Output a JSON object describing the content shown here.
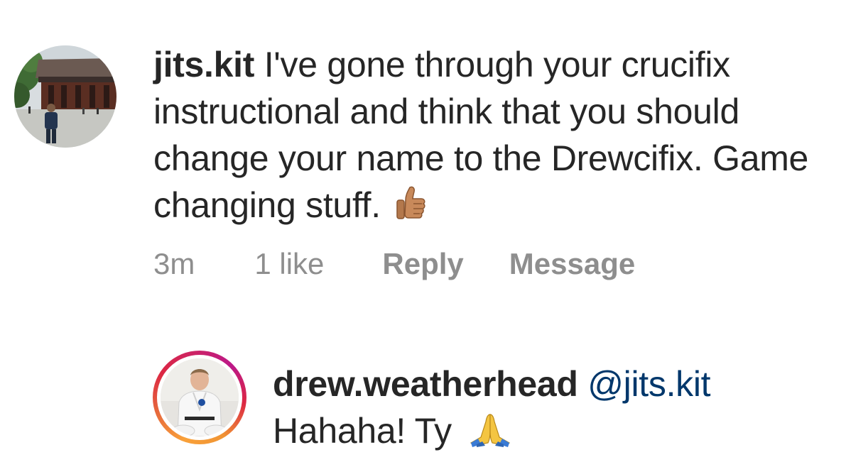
{
  "comment": {
    "username": "jits.kit",
    "text": "I've gone through your crucifix instructional and think that you should change your name to the Drewcifix. Game changing stuff.",
    "emoji": "thumbs-up-icon",
    "time": "3m",
    "likes": "1 like",
    "reply_label": "Reply",
    "message_label": "Message"
  },
  "reply": {
    "username": "drew.weatherhead",
    "mention": "@jits.kit",
    "text": "Hahaha! Ty",
    "emoji": "praying-hands-icon"
  },
  "colors": {
    "text": "#262626",
    "meta": "#8e8e8e",
    "mention": "#00376b",
    "story_ring_start": "#f9a13a",
    "story_ring_end": "#bc1888"
  }
}
